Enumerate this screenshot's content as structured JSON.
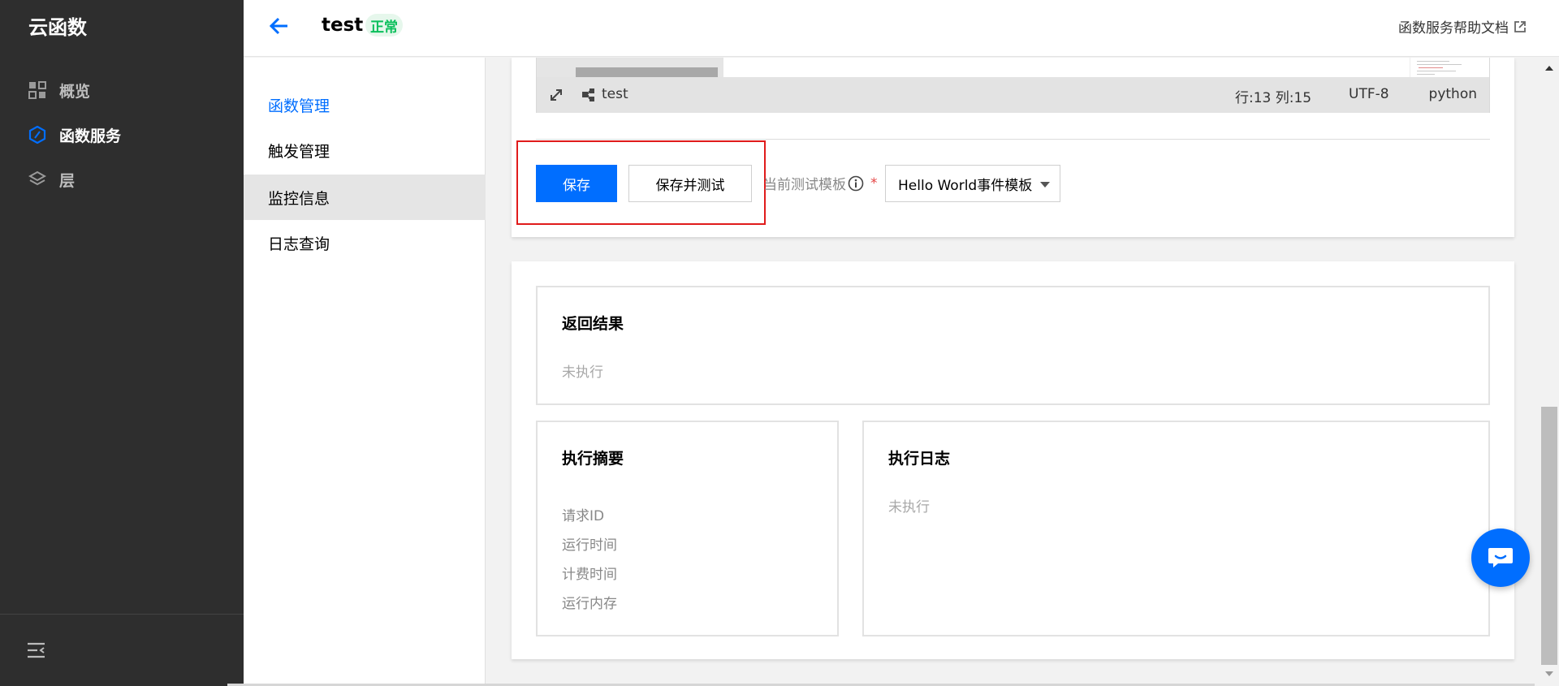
{
  "sidebar": {
    "brand": "云函数",
    "items": [
      {
        "label": "概览",
        "icon": "grid-icon"
      },
      {
        "label": "函数服务",
        "icon": "function-icon"
      },
      {
        "label": "层",
        "icon": "layers-icon"
      }
    ],
    "active_index": 1
  },
  "header": {
    "title": "test",
    "status_badge": "正常",
    "help_link": "函数服务帮助文档"
  },
  "submenu": {
    "items": [
      "函数管理",
      "触发管理",
      "监控信息",
      "日志查询"
    ],
    "active_index": 0,
    "hover_index": 2
  },
  "editor": {
    "file_name": "test",
    "cursor_position": "行:13 列:15",
    "encoding": "UTF-8",
    "language": "python"
  },
  "actions": {
    "save_label": "保存",
    "save_and_test_label": "保存并测试",
    "template_label": "当前测试模板",
    "required_mark": "*",
    "template_value": "Hello World事件模板"
  },
  "result": {
    "title": "返回结果",
    "status": "未执行"
  },
  "summary": {
    "title": "执行摘要",
    "fields": [
      "请求ID",
      "运行时间",
      "计费时间",
      "运行内存"
    ]
  },
  "log": {
    "title": "执行日志",
    "status": "未执行"
  },
  "colors": {
    "primary": "#006eff",
    "sidebar_bg": "#2e2e2e",
    "status_green": "#0abf5b",
    "highlight_red": "#e01b1b"
  }
}
